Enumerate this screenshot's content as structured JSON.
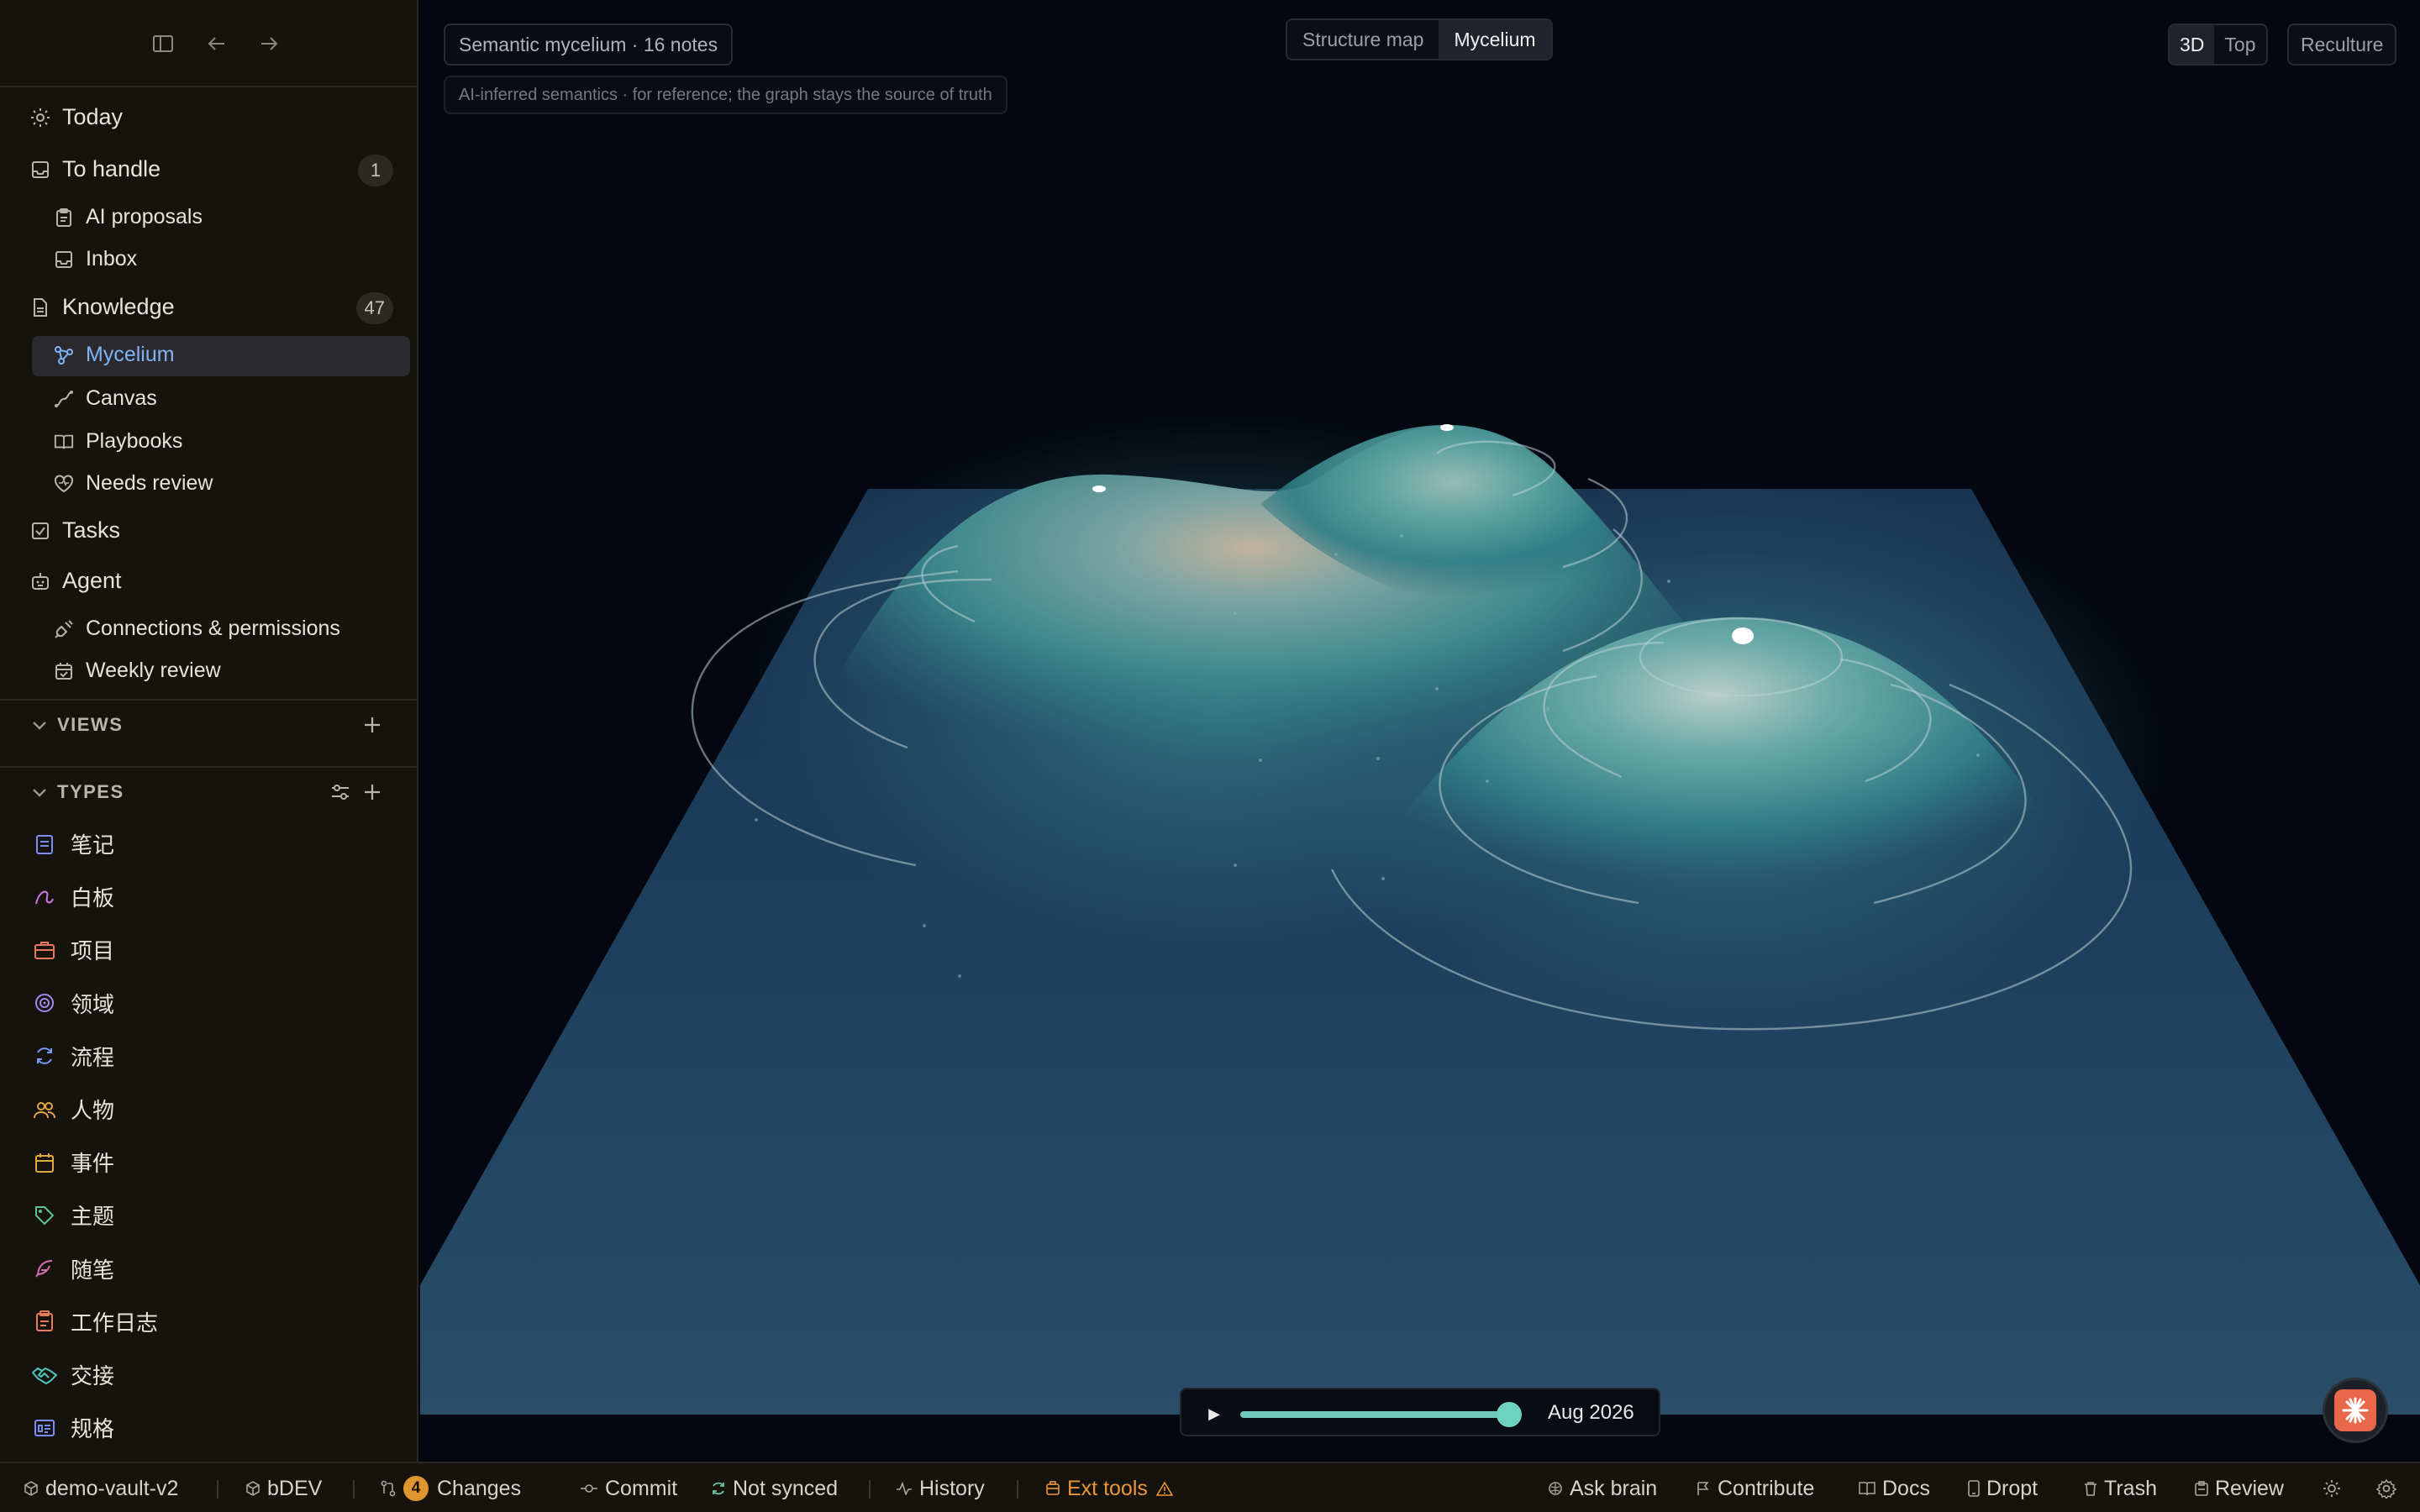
{
  "sidebar": {
    "items": {
      "today": "Today",
      "to_handle": "To handle",
      "to_handle_count": "1",
      "ai_proposals": "AI proposals",
      "inbox": "Inbox",
      "knowledge": "Knowledge",
      "knowledge_count": "47",
      "mycelium": "Mycelium",
      "canvas": "Canvas",
      "playbooks": "Playbooks",
      "needs_review": "Needs review",
      "tasks": "Tasks",
      "agent": "Agent",
      "connections": "Connections & permissions",
      "weekly_review": "Weekly review"
    },
    "views_label": "VIEWS",
    "types_label": "TYPES",
    "types": [
      "笔记",
      "白板",
      "项目",
      "领域",
      "流程",
      "人物",
      "事件",
      "主题",
      "随笔",
      "工作日志",
      "交接",
      "规格"
    ],
    "type_colors": [
      "#7b8cf5",
      "#c77be0",
      "#e8795a",
      "#9c8cf0",
      "#7b9cf5",
      "#e0a93f",
      "#e0a93f",
      "#5fc48a",
      "#d86bb0",
      "#e8795a",
      "#4fc6c0",
      "#7b8cf5"
    ]
  },
  "main": {
    "title": "Semantic mycelium · 16 notes",
    "subtitle": "AI-inferred semantics · for reference; the graph stays the source of truth",
    "modes": [
      "Structure map",
      "Mycelium"
    ],
    "active_mode": "Mycelium",
    "views": [
      "3D",
      "Top"
    ],
    "active_view": "3D",
    "reculture_label": "Reculture",
    "timeline": {
      "date": "Aug 2026",
      "progress": 1.0
    }
  },
  "statusbar": {
    "vault": "demo-vault-v2",
    "branch": "bDEV",
    "changes_count": "4",
    "changes": "Changes",
    "commit": "Commit",
    "sync": "Not synced",
    "history": "History",
    "ext_tools": "Ext tools",
    "ask_brain": "Ask brain",
    "contribute": "Contribute",
    "docs": "Docs",
    "dropt": "Dropt",
    "trash": "Trash",
    "review": "Review"
  },
  "colors": {
    "accent": "#7fb3f5",
    "terrain": "#3e8a8e",
    "ext": "#e8963a"
  }
}
